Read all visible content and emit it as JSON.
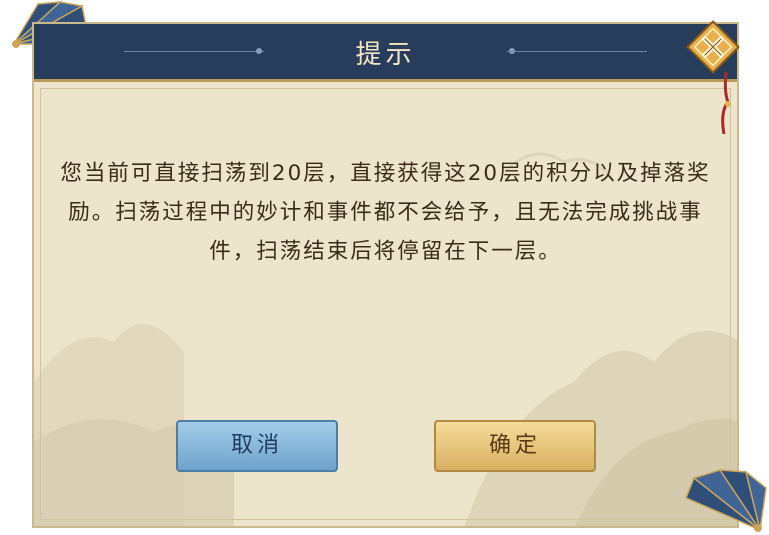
{
  "dialog": {
    "title": "提示",
    "message": "您当前可直接扫荡到20层，直接获得这20层的积分以及掉落奖励。扫荡过程中的妙计和事件都不会给予，且无法完成挑战事件，扫荡结束后将停留在下一层。",
    "cancel_label": "取消",
    "confirm_label": "确定"
  },
  "icons": {
    "close": "close-x-icon",
    "top_left_decor": "folding-fan-icon",
    "bottom_right_decor": "folding-fan-icon"
  },
  "colors": {
    "header_bg": "#283c5c",
    "panel_bg": "#ece4cb",
    "cancel_button": "#6fa3cc",
    "confirm_button": "#d9b060",
    "close_button": "#e6b04a"
  }
}
